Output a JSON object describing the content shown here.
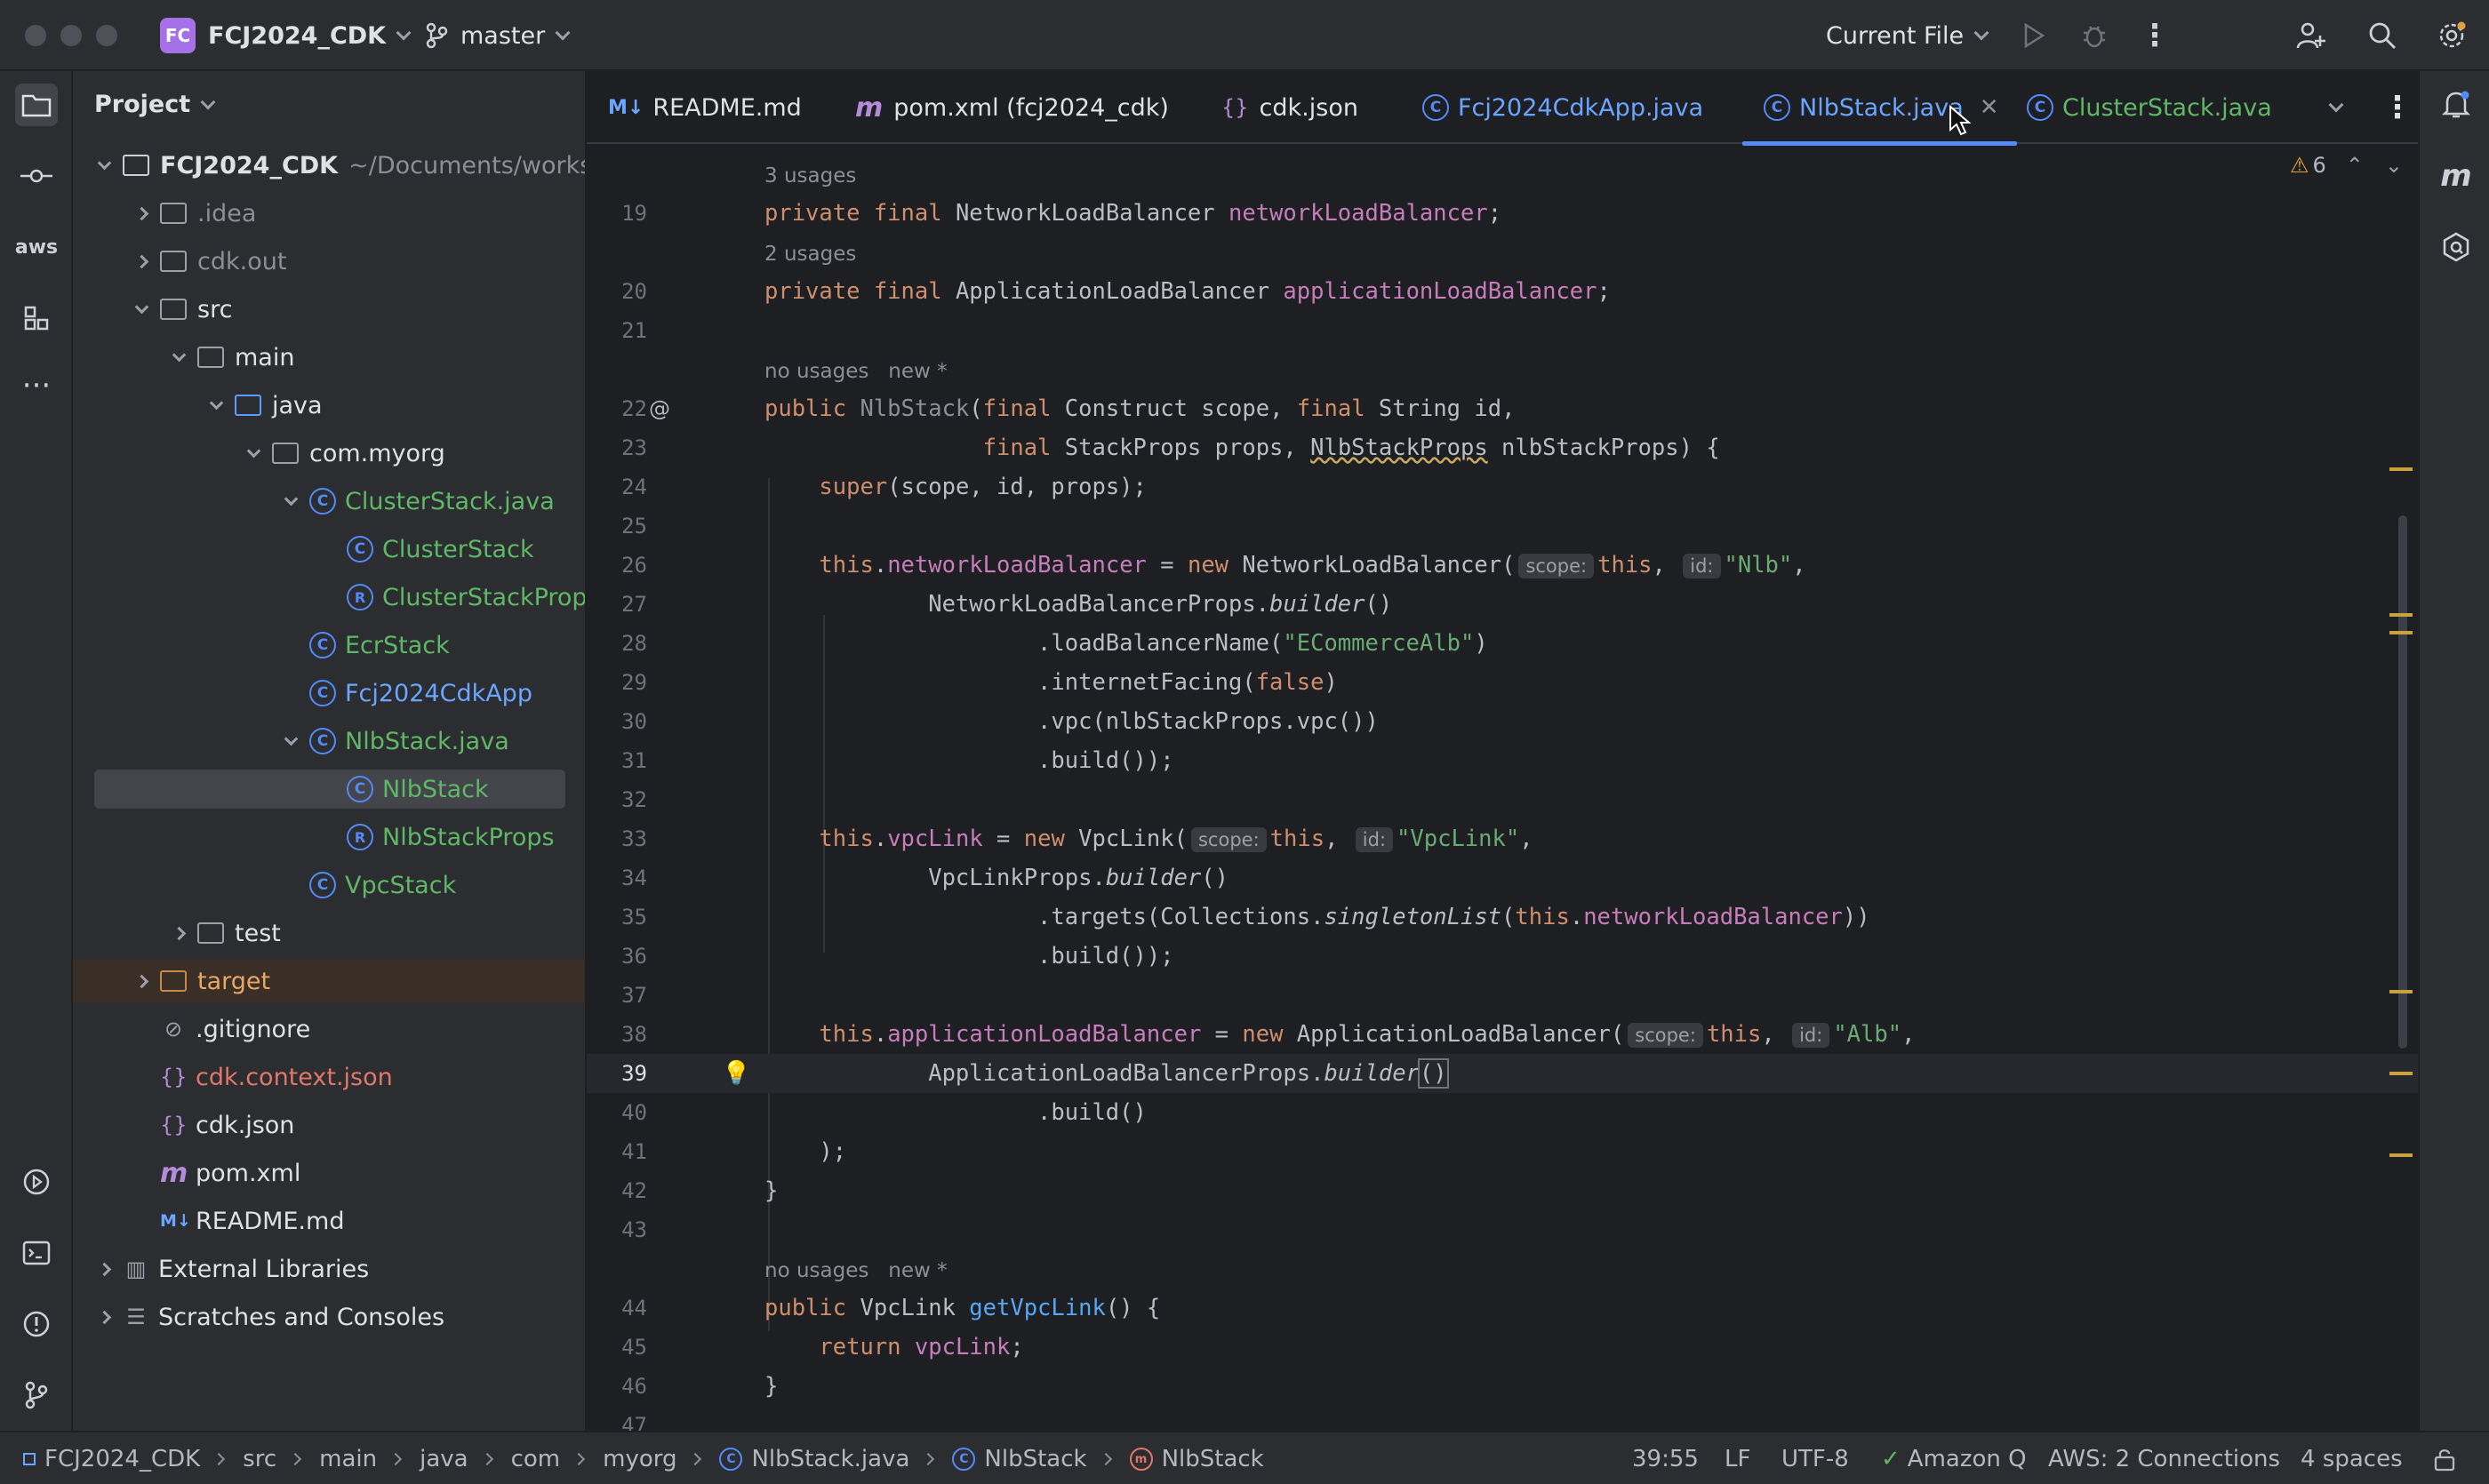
{
  "titlebar": {
    "project_badge": "FC",
    "project_name": "FCJ2024_CDK",
    "branch": "master",
    "run_config": "Current File"
  },
  "project_panel": {
    "title": "Project",
    "tree": [
      {
        "label": "FCJ2024_CDK",
        "extra": "~/Documents/workshop",
        "depth": 0,
        "arrow": "down",
        "icon": "folder-module",
        "color": "bold"
      },
      {
        "label": ".idea",
        "depth": 1,
        "arrow": "right",
        "icon": "folder",
        "color": "muted"
      },
      {
        "label": "cdk.out",
        "depth": 1,
        "arrow": "right",
        "icon": "folder",
        "color": "muted"
      },
      {
        "label": "src",
        "depth": 1,
        "arrow": "down",
        "icon": "folder",
        "color": "normal"
      },
      {
        "label": "main",
        "depth": 2,
        "arrow": "down",
        "icon": "folder",
        "color": "normal"
      },
      {
        "label": "java",
        "depth": 3,
        "arrow": "down",
        "icon": "folder-blue",
        "color": "normal"
      },
      {
        "label": "com.myorg",
        "depth": 4,
        "arrow": "down",
        "icon": "package",
        "color": "normal"
      },
      {
        "label": "ClusterStack.java",
        "depth": 5,
        "arrow": "down",
        "icon": "class",
        "color": "green"
      },
      {
        "label": "ClusterStack",
        "depth": 6,
        "arrow": "none",
        "icon": "class",
        "color": "green"
      },
      {
        "label": "ClusterStackProps",
        "depth": 6,
        "arrow": "none",
        "icon": "record",
        "color": "green"
      },
      {
        "label": "EcrStack",
        "depth": 5,
        "arrow": "none",
        "icon": "class",
        "color": "green"
      },
      {
        "label": "Fcj2024CdkApp",
        "depth": 5,
        "arrow": "none",
        "icon": "class",
        "color": "blue"
      },
      {
        "label": "NlbStack.java",
        "depth": 5,
        "arrow": "down",
        "icon": "class",
        "color": "green"
      },
      {
        "label": "NlbStack",
        "depth": 6,
        "arrow": "none",
        "icon": "class",
        "color": "green",
        "selected": true
      },
      {
        "label": "NlbStackProps",
        "depth": 6,
        "arrow": "none",
        "icon": "record",
        "color": "green"
      },
      {
        "label": "VpcStack",
        "depth": 5,
        "arrow": "none",
        "icon": "class",
        "color": "green"
      },
      {
        "label": "test",
        "depth": 2,
        "arrow": "right",
        "icon": "folder",
        "color": "normal"
      },
      {
        "label": "target",
        "depth": 1,
        "arrow": "right",
        "icon": "folder-orange",
        "color": "orange",
        "excluded": true
      },
      {
        "label": ".gitignore",
        "depth": 1,
        "arrow": "none",
        "icon": "ignore",
        "color": "normal"
      },
      {
        "label": "cdk.context.json",
        "depth": 1,
        "arrow": "none",
        "icon": "json",
        "color": "red"
      },
      {
        "label": "cdk.json",
        "depth": 1,
        "arrow": "none",
        "icon": "json",
        "color": "normal"
      },
      {
        "label": "pom.xml",
        "depth": 1,
        "arrow": "none",
        "icon": "maven",
        "color": "normal"
      },
      {
        "label": "README.md",
        "depth": 1,
        "arrow": "none",
        "icon": "markdown",
        "color": "normal"
      },
      {
        "label": "External Libraries",
        "depth": 0,
        "arrow": "right",
        "icon": "libraries",
        "color": "normal"
      },
      {
        "label": "Scratches and Consoles",
        "depth": 0,
        "arrow": "right",
        "icon": "scratches",
        "color": "normal"
      }
    ]
  },
  "tabs": [
    {
      "label": "README.md",
      "icon": "markdown"
    },
    {
      "label": "pom.xml (fcj2024_cdk)",
      "icon": "maven"
    },
    {
      "label": "cdk.json",
      "icon": "json"
    },
    {
      "label": "Fcj2024CdkApp.java",
      "icon": "class",
      "color": "blue"
    },
    {
      "label": "NlbStack.java",
      "icon": "class",
      "active": true
    },
    {
      "label": "ClusterStack.java",
      "icon": "class",
      "color": "green"
    }
  ],
  "editor": {
    "warning_count": "6",
    "hints": {
      "usages3": "3 usages",
      "usages2": "2 usages",
      "no_usages": "no usages",
      "new": "new *"
    },
    "line_numbers": [
      "19",
      "20",
      "21",
      "22",
      "23",
      "24",
      "25",
      "26",
      "27",
      "28",
      "29",
      "30",
      "31",
      "32",
      "33",
      "34",
      "35",
      "36",
      "37",
      "38",
      "39",
      "40",
      "41",
      "42",
      "43",
      "44",
      "45",
      "46",
      "47"
    ],
    "inlay": {
      "scope": "scope:",
      "id": "id:"
    },
    "strings": {
      "nlb": "\"Nlb\"",
      "alb_name": "\"ECommerceAlb\"",
      "vpclink": "\"VpcLink\"",
      "alb": "\"Alb\""
    }
  },
  "statusbar": {
    "breadcrumbs": [
      "FCJ2024_CDK",
      "src",
      "main",
      "java",
      "com",
      "myorg",
      "NlbStack.java",
      "NlbStack",
      "NlbStack"
    ],
    "position": "39:55",
    "line_sep": "LF",
    "encoding": "UTF-8",
    "amazon_q": "Amazon Q",
    "aws": "AWS: 2 Connections",
    "indent": "4 spaces"
  },
  "colors": {
    "accent": "#548af7",
    "keyword": "#cf8e6d",
    "field": "#c77dbb",
    "string": "#6aab73",
    "background": "#1e1f22"
  }
}
